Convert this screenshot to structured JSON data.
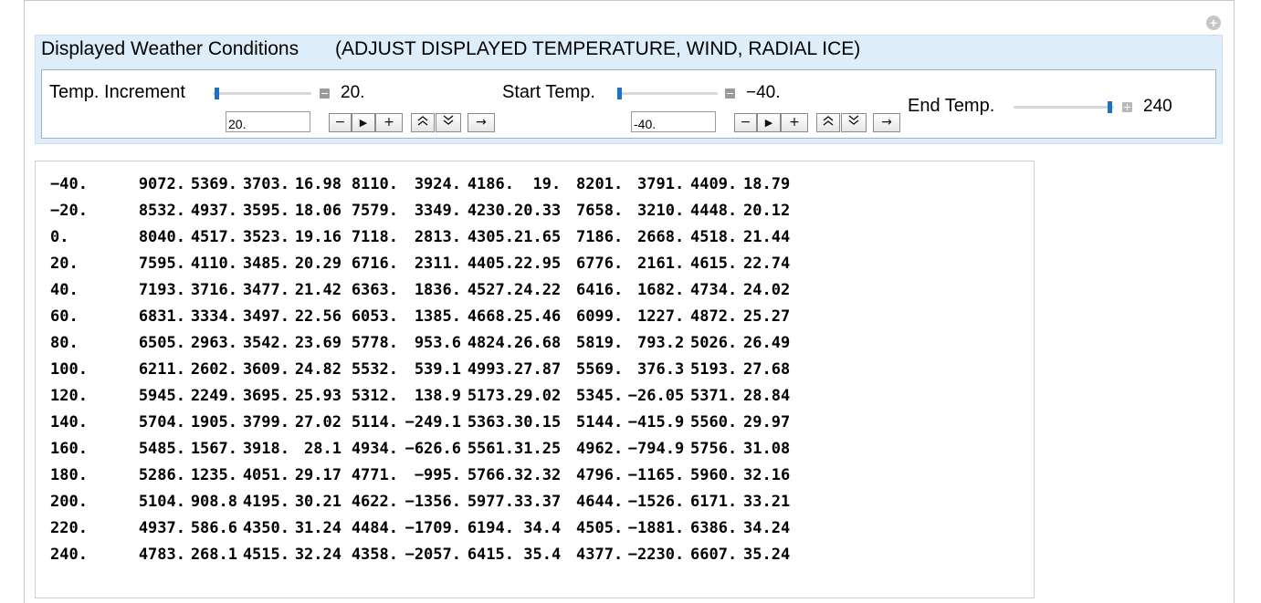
{
  "header": {
    "title": "Displayed Weather Conditions",
    "subtitle": "(ADJUST DISPLAYED TEMPERATURE, WIND, RADIAL ICE)"
  },
  "controls": {
    "temp_increment": {
      "label": "Temp. Increment",
      "value": "20.",
      "input_value": "20."
    },
    "start_temp": {
      "label": "Start Temp.",
      "value": "−40.",
      "input_value": "-40."
    },
    "end_temp": {
      "label": "End Temp.",
      "value": "240"
    },
    "buttons": {
      "minus": "−",
      "play": "▶",
      "plus": "+",
      "faster": "⌃",
      "slower": "⌄",
      "direction": "→"
    }
  },
  "table": {
    "rows": [
      [
        "−40.",
        "9072.",
        "5369.",
        "3703.",
        "16.98",
        "8110.",
        "3924.",
        "4186.",
        "19.",
        "8201.",
        "3791.",
        "4409.",
        "18.79"
      ],
      [
        "−20.",
        "8532.",
        "4937.",
        "3595.",
        "18.06",
        "7579.",
        "3349.",
        "4230.",
        "20.33",
        "7658.",
        "3210.",
        "4448.",
        "20.12"
      ],
      [
        "0.",
        "8040.",
        "4517.",
        "3523.",
        "19.16",
        "7118.",
        "2813.",
        "4305.",
        "21.65",
        "7186.",
        "2668.",
        "4518.",
        "21.44"
      ],
      [
        "20.",
        "7595.",
        "4110.",
        "3485.",
        "20.29",
        "6716.",
        "2311.",
        "4405.",
        "22.95",
        "6776.",
        "2161.",
        "4615.",
        "22.74"
      ],
      [
        "40.",
        "7193.",
        "3716.",
        "3477.",
        "21.42",
        "6363.",
        "1836.",
        "4527.",
        "24.22",
        "6416.",
        "1682.",
        "4734.",
        "24.02"
      ],
      [
        "60.",
        "6831.",
        "3334.",
        "3497.",
        "22.56",
        "6053.",
        "1385.",
        "4668.",
        "25.46",
        "6099.",
        "1227.",
        "4872.",
        "25.27"
      ],
      [
        "80.",
        "6505.",
        "2963.",
        "3542.",
        "23.69",
        "5778.",
        "953.6",
        "4824.",
        "26.68",
        "5819.",
        "793.2",
        "5026.",
        "26.49"
      ],
      [
        "100.",
        "6211.",
        "2602.",
        "3609.",
        "24.82",
        "5532.",
        "539.1",
        "4993.",
        "27.87",
        "5569.",
        "376.3",
        "5193.",
        "27.68"
      ],
      [
        "120.",
        "5945.",
        "2249.",
        "3695.",
        "25.93",
        "5312.",
        "138.9",
        "5173.",
        "29.02",
        "5345.",
        "−26.05",
        "5371.",
        "28.84"
      ],
      [
        "140.",
        "5704.",
        "1905.",
        "3799.",
        "27.02",
        "5114.",
        "−249.1",
        "5363.",
        "30.15",
        "5144.",
        "−415.9",
        "5560.",
        "29.97"
      ],
      [
        "160.",
        "5485.",
        "1567.",
        "3918.",
        "28.1",
        "4934.",
        "−626.6",
        "5561.",
        "31.25",
        "4962.",
        "−794.9",
        "5756.",
        "31.08"
      ],
      [
        "180.",
        "5286.",
        "1235.",
        "4051.",
        "29.17",
        "4771.",
        "−995.",
        "5766.",
        "32.32",
        "4796.",
        "−1165.",
        "5960.",
        "32.16"
      ],
      [
        "200.",
        "5104.",
        "908.8",
        "4195.",
        "30.21",
        "4622.",
        "−1356.",
        "5977.",
        "33.37",
        "4644.",
        "−1526.",
        "6171.",
        "33.21"
      ],
      [
        "220.",
        "4937.",
        "586.6",
        "4350.",
        "31.24",
        "4484.",
        "−1709.",
        "6194.",
        "34.4",
        "4505.",
        "−1881.",
        "6386.",
        "34.24"
      ],
      [
        "240.",
        "4783.",
        "268.1",
        "4515.",
        "32.24",
        "4358.",
        "−2057.",
        "6415.",
        "35.4",
        "4377.",
        "−2230.",
        "6607.",
        "35.24"
      ]
    ]
  }
}
